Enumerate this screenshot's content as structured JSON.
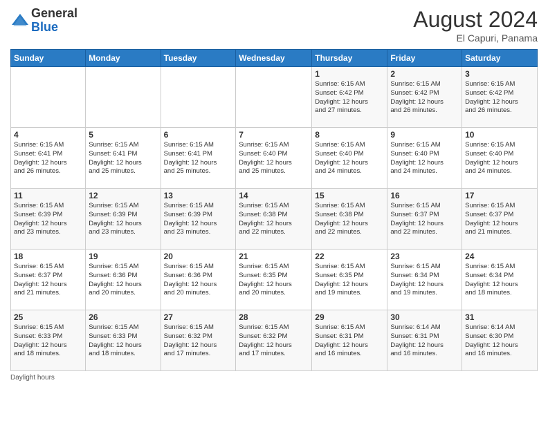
{
  "header": {
    "logo_line1": "General",
    "logo_line2": "Blue",
    "month_year": "August 2024",
    "location": "El Capuri, Panama"
  },
  "weekdays": [
    "Sunday",
    "Monday",
    "Tuesday",
    "Wednesday",
    "Thursday",
    "Friday",
    "Saturday"
  ],
  "weeks": [
    [
      {
        "day": "",
        "info": ""
      },
      {
        "day": "",
        "info": ""
      },
      {
        "day": "",
        "info": ""
      },
      {
        "day": "",
        "info": ""
      },
      {
        "day": "1",
        "info": "Sunrise: 6:15 AM\nSunset: 6:42 PM\nDaylight: 12 hours\nand 27 minutes."
      },
      {
        "day": "2",
        "info": "Sunrise: 6:15 AM\nSunset: 6:42 PM\nDaylight: 12 hours\nand 26 minutes."
      },
      {
        "day": "3",
        "info": "Sunrise: 6:15 AM\nSunset: 6:42 PM\nDaylight: 12 hours\nand 26 minutes."
      }
    ],
    [
      {
        "day": "4",
        "info": "Sunrise: 6:15 AM\nSunset: 6:41 PM\nDaylight: 12 hours\nand 26 minutes."
      },
      {
        "day": "5",
        "info": "Sunrise: 6:15 AM\nSunset: 6:41 PM\nDaylight: 12 hours\nand 25 minutes."
      },
      {
        "day": "6",
        "info": "Sunrise: 6:15 AM\nSunset: 6:41 PM\nDaylight: 12 hours\nand 25 minutes."
      },
      {
        "day": "7",
        "info": "Sunrise: 6:15 AM\nSunset: 6:40 PM\nDaylight: 12 hours\nand 25 minutes."
      },
      {
        "day": "8",
        "info": "Sunrise: 6:15 AM\nSunset: 6:40 PM\nDaylight: 12 hours\nand 24 minutes."
      },
      {
        "day": "9",
        "info": "Sunrise: 6:15 AM\nSunset: 6:40 PM\nDaylight: 12 hours\nand 24 minutes."
      },
      {
        "day": "10",
        "info": "Sunrise: 6:15 AM\nSunset: 6:40 PM\nDaylight: 12 hours\nand 24 minutes."
      }
    ],
    [
      {
        "day": "11",
        "info": "Sunrise: 6:15 AM\nSunset: 6:39 PM\nDaylight: 12 hours\nand 23 minutes."
      },
      {
        "day": "12",
        "info": "Sunrise: 6:15 AM\nSunset: 6:39 PM\nDaylight: 12 hours\nand 23 minutes."
      },
      {
        "day": "13",
        "info": "Sunrise: 6:15 AM\nSunset: 6:39 PM\nDaylight: 12 hours\nand 23 minutes."
      },
      {
        "day": "14",
        "info": "Sunrise: 6:15 AM\nSunset: 6:38 PM\nDaylight: 12 hours\nand 22 minutes."
      },
      {
        "day": "15",
        "info": "Sunrise: 6:15 AM\nSunset: 6:38 PM\nDaylight: 12 hours\nand 22 minutes."
      },
      {
        "day": "16",
        "info": "Sunrise: 6:15 AM\nSunset: 6:37 PM\nDaylight: 12 hours\nand 22 minutes."
      },
      {
        "day": "17",
        "info": "Sunrise: 6:15 AM\nSunset: 6:37 PM\nDaylight: 12 hours\nand 21 minutes."
      }
    ],
    [
      {
        "day": "18",
        "info": "Sunrise: 6:15 AM\nSunset: 6:37 PM\nDaylight: 12 hours\nand 21 minutes."
      },
      {
        "day": "19",
        "info": "Sunrise: 6:15 AM\nSunset: 6:36 PM\nDaylight: 12 hours\nand 20 minutes."
      },
      {
        "day": "20",
        "info": "Sunrise: 6:15 AM\nSunset: 6:36 PM\nDaylight: 12 hours\nand 20 minutes."
      },
      {
        "day": "21",
        "info": "Sunrise: 6:15 AM\nSunset: 6:35 PM\nDaylight: 12 hours\nand 20 minutes."
      },
      {
        "day": "22",
        "info": "Sunrise: 6:15 AM\nSunset: 6:35 PM\nDaylight: 12 hours\nand 19 minutes."
      },
      {
        "day": "23",
        "info": "Sunrise: 6:15 AM\nSunset: 6:34 PM\nDaylight: 12 hours\nand 19 minutes."
      },
      {
        "day": "24",
        "info": "Sunrise: 6:15 AM\nSunset: 6:34 PM\nDaylight: 12 hours\nand 18 minutes."
      }
    ],
    [
      {
        "day": "25",
        "info": "Sunrise: 6:15 AM\nSunset: 6:33 PM\nDaylight: 12 hours\nand 18 minutes."
      },
      {
        "day": "26",
        "info": "Sunrise: 6:15 AM\nSunset: 6:33 PM\nDaylight: 12 hours\nand 18 minutes."
      },
      {
        "day": "27",
        "info": "Sunrise: 6:15 AM\nSunset: 6:32 PM\nDaylight: 12 hours\nand 17 minutes."
      },
      {
        "day": "28",
        "info": "Sunrise: 6:15 AM\nSunset: 6:32 PM\nDaylight: 12 hours\nand 17 minutes."
      },
      {
        "day": "29",
        "info": "Sunrise: 6:15 AM\nSunset: 6:31 PM\nDaylight: 12 hours\nand 16 minutes."
      },
      {
        "day": "30",
        "info": "Sunrise: 6:14 AM\nSunset: 6:31 PM\nDaylight: 12 hours\nand 16 minutes."
      },
      {
        "day": "31",
        "info": "Sunrise: 6:14 AM\nSunset: 6:30 PM\nDaylight: 12 hours\nand 16 minutes."
      }
    ]
  ],
  "footer": "Daylight hours"
}
